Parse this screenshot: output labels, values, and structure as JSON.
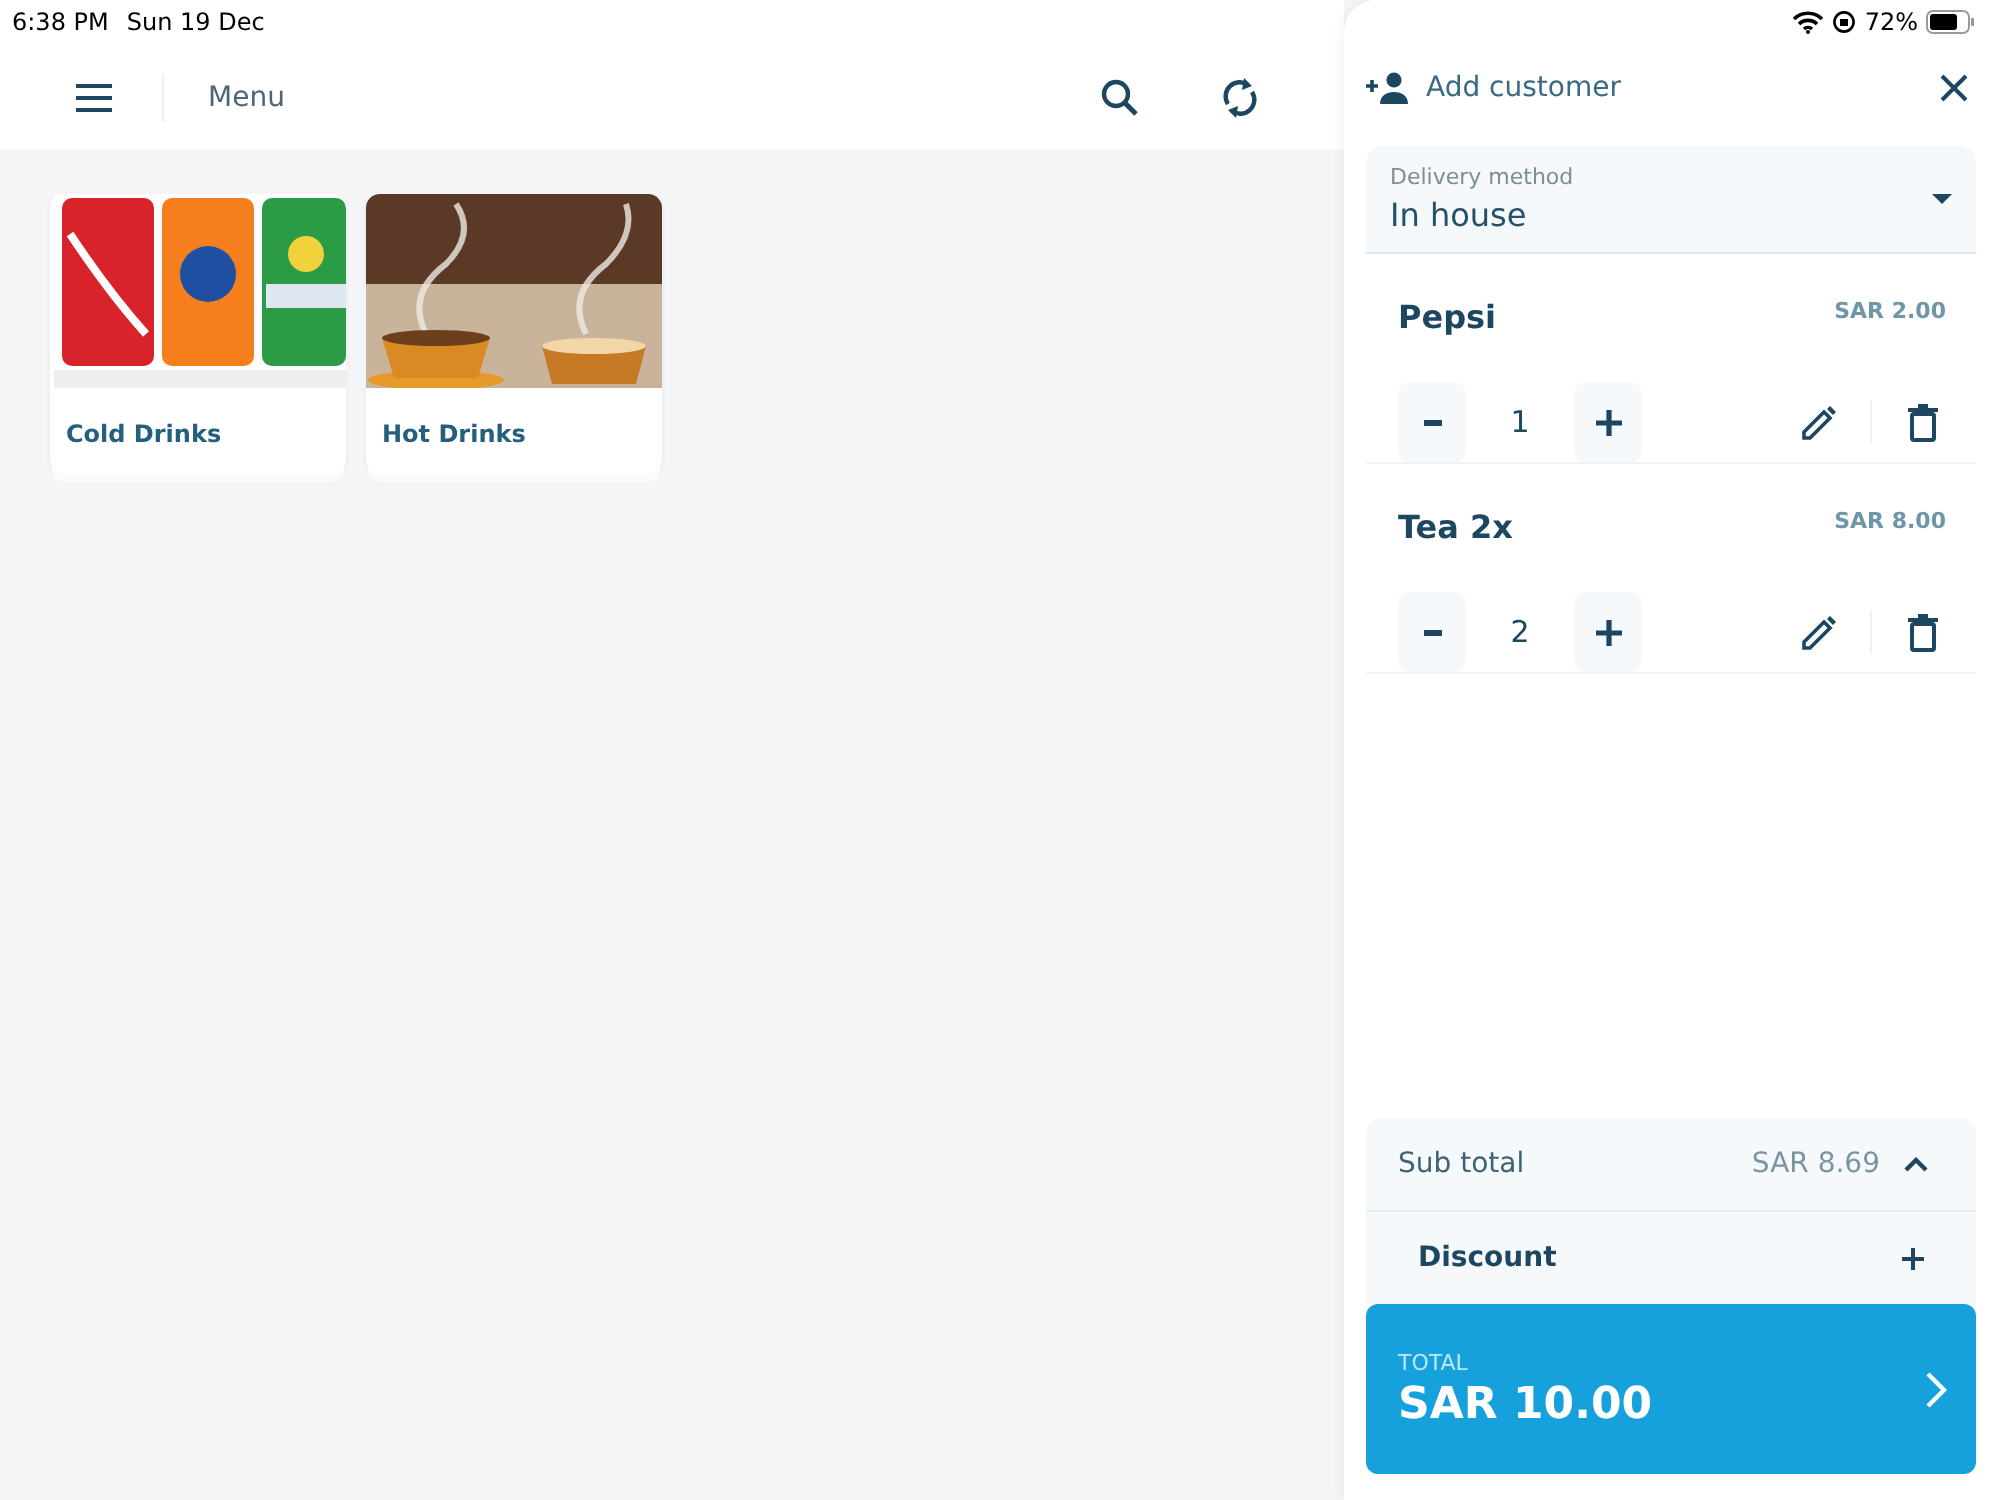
{
  "status_bar": {
    "time": "6:38 PM",
    "date": "Sun 19 Dec",
    "battery_text": "72%"
  },
  "top_bar": {
    "title": "Menu"
  },
  "categories": [
    {
      "label": "Cold Drinks",
      "kind": "picture"
    },
    {
      "label": "Hot Drinks",
      "kind": "picture"
    }
  ],
  "cart": {
    "add_customer": "Add customer",
    "delivery": {
      "label": "Delivery method",
      "value": "In house"
    },
    "items": [
      {
        "name": "Pepsi",
        "price": "SAR 2.00",
        "quantity": "1"
      },
      {
        "name": "Tea 2x",
        "price": "SAR 8.00",
        "quantity": "2"
      }
    ],
    "subtotal": {
      "label": "Sub total",
      "value": "SAR 8.69",
      "expanded": true
    },
    "discount": {
      "label": "Discount"
    },
    "total": {
      "label": "TOTAL",
      "value": "SAR 10.00"
    }
  }
}
